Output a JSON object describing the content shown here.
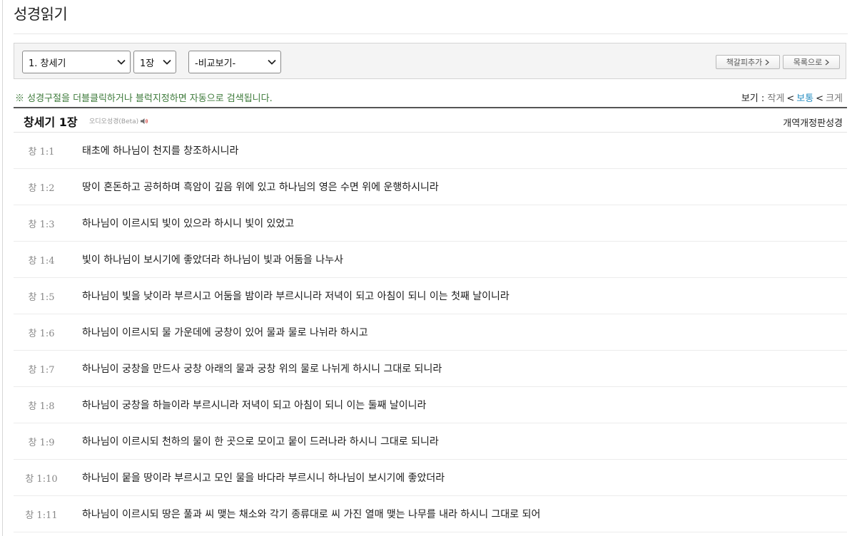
{
  "page": {
    "title": "성경읽기"
  },
  "toolbar": {
    "book_select": "1. 창세기",
    "chapter_select": "1장",
    "compare_select": "-비교보기-",
    "bookmark_label": "책갈피추가",
    "list_label": "목록으로"
  },
  "notice": "※ 성경구절을 더블클릭하거나 블럭지정하면 자동으로 검색됩니다.",
  "view_size": {
    "label": "보기 : ",
    "small": "작게",
    "normal": "보통",
    "large": "크게",
    "separator": "<",
    "active": "normal",
    "active_color": "#2a8fc2"
  },
  "chapter": {
    "title": "창세기 1장",
    "audio_label": "오디오성경(Beta)",
    "version": "개역개정판성경"
  },
  "verses": [
    {
      "ref": "창 1:1",
      "text": "태초에 하나님이 천지를 창조하시니라"
    },
    {
      "ref": "창 1:2",
      "text": "땅이 혼돈하고 공허하며 흑암이 깊음 위에 있고 하나님의 영은 수면 위에 운행하시니라"
    },
    {
      "ref": "창 1:3",
      "text": "하나님이 이르시되 빛이 있으라 하시니 빛이 있었고"
    },
    {
      "ref": "창 1:4",
      "text": "빛이 하나님이 보시기에 좋았더라 하나님이 빛과 어둠을 나누사"
    },
    {
      "ref": "창 1:5",
      "text": "하나님이 빛을 낮이라 부르시고 어둠을 밤이라 부르시니라 저녁이 되고 아침이 되니 이는 첫째 날이니라"
    },
    {
      "ref": "창 1:6",
      "text": "하나님이 이르시되 물 가운데에 궁창이 있어 물과 물로 나뉘라 하시고"
    },
    {
      "ref": "창 1:7",
      "text": "하나님이 궁창을 만드사 궁창 아래의 물과 궁창 위의 물로 나뉘게 하시니 그대로 되니라"
    },
    {
      "ref": "창 1:8",
      "text": "하나님이 궁창을 하늘이라 부르시니라 저녁이 되고 아침이 되니 이는 둘째 날이니라"
    },
    {
      "ref": "창 1:9",
      "text": "하나님이 이르시되 천하의 물이 한 곳으로 모이고 뭍이 드러나라 하시니 그대로 되니라"
    },
    {
      "ref": "창 1:10",
      "text": "하나님이 뭍을 땅이라 부르시고 모인 물을 바다라 부르시니 하나님이 보시기에 좋았더라"
    },
    {
      "ref": "창 1:11",
      "text": "하나님이 이르시되 땅은 풀과 씨 맺는 채소와 각기 종류대로 씨 가진 열매 맺는 나무를 내라 하시니 그대로 되어"
    }
  ]
}
